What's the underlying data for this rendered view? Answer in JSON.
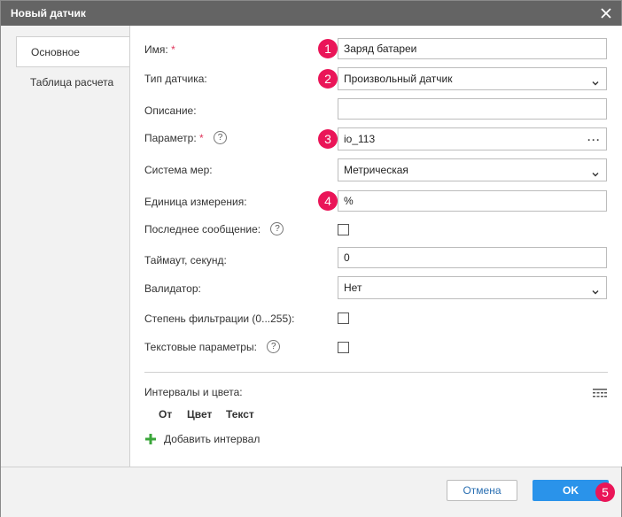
{
  "dialog": {
    "title": "Новый датчик"
  },
  "tabs": [
    {
      "label": "Основное",
      "active": true
    },
    {
      "label": "Таблица расчета",
      "active": false
    }
  ],
  "form": {
    "name": {
      "label": "Имя:",
      "required": "*",
      "value": "Заряд батареи"
    },
    "type": {
      "label": "Тип датчика:",
      "value": "Произвольный датчик"
    },
    "description": {
      "label": "Описание:",
      "value": ""
    },
    "parameter": {
      "label": "Параметр:",
      "required": "*",
      "help": "?",
      "value": "io_113",
      "menu": "···"
    },
    "measure_system": {
      "label": "Система мер:",
      "value": "Метрическая"
    },
    "unit": {
      "label": "Единица измерения:",
      "value": "%"
    },
    "last_message": {
      "label": "Последнее сообщение:",
      "help": "?",
      "checked": false
    },
    "timeout": {
      "label": "Таймаут, секунд:",
      "value": "0"
    },
    "validator": {
      "label": "Валидатор:",
      "value": "Нет"
    },
    "filter": {
      "label": "Степень фильтрации (0...255):",
      "checked": false
    },
    "text_params": {
      "label": "Текстовые параметры:",
      "help": "?",
      "checked": false
    }
  },
  "intervals": {
    "title": "Интервалы и цвета:",
    "columns": [
      "От",
      "Цвет",
      "Текст"
    ],
    "add_label": "Добавить интервал"
  },
  "buttons": {
    "cancel": "Отмена",
    "ok": "OK"
  },
  "badges": [
    "1",
    "2",
    "3",
    "4",
    "5"
  ],
  "colors": {
    "titlebar": "#646464",
    "accent": "#2a93ea",
    "badge": "#ea1558",
    "add_icon": "#3aa63a"
  },
  "icons": {
    "close": "close-icon",
    "chevron": "chevron-down-icon",
    "help": "help-circle-icon",
    "add": "plus-icon",
    "table": "table-grid-icon"
  }
}
